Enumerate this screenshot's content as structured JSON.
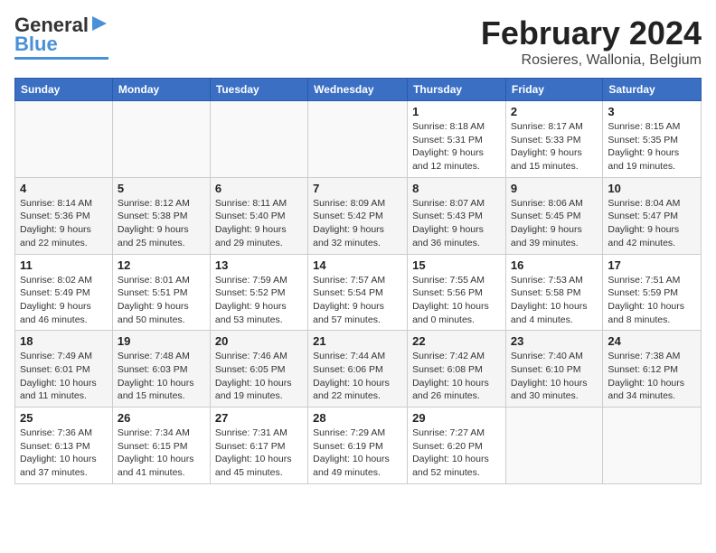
{
  "logo": {
    "line1": "General",
    "line2": "Blue"
  },
  "title": "February 2024",
  "subtitle": "Rosieres, Wallonia, Belgium",
  "days_of_week": [
    "Sunday",
    "Monday",
    "Tuesday",
    "Wednesday",
    "Thursday",
    "Friday",
    "Saturday"
  ],
  "weeks": [
    [
      {
        "day": "",
        "info": ""
      },
      {
        "day": "",
        "info": ""
      },
      {
        "day": "",
        "info": ""
      },
      {
        "day": "",
        "info": ""
      },
      {
        "day": "1",
        "info": "Sunrise: 8:18 AM\nSunset: 5:31 PM\nDaylight: 9 hours\nand 12 minutes."
      },
      {
        "day": "2",
        "info": "Sunrise: 8:17 AM\nSunset: 5:33 PM\nDaylight: 9 hours\nand 15 minutes."
      },
      {
        "day": "3",
        "info": "Sunrise: 8:15 AM\nSunset: 5:35 PM\nDaylight: 9 hours\nand 19 minutes."
      }
    ],
    [
      {
        "day": "4",
        "info": "Sunrise: 8:14 AM\nSunset: 5:36 PM\nDaylight: 9 hours\nand 22 minutes."
      },
      {
        "day": "5",
        "info": "Sunrise: 8:12 AM\nSunset: 5:38 PM\nDaylight: 9 hours\nand 25 minutes."
      },
      {
        "day": "6",
        "info": "Sunrise: 8:11 AM\nSunset: 5:40 PM\nDaylight: 9 hours\nand 29 minutes."
      },
      {
        "day": "7",
        "info": "Sunrise: 8:09 AM\nSunset: 5:42 PM\nDaylight: 9 hours\nand 32 minutes."
      },
      {
        "day": "8",
        "info": "Sunrise: 8:07 AM\nSunset: 5:43 PM\nDaylight: 9 hours\nand 36 minutes."
      },
      {
        "day": "9",
        "info": "Sunrise: 8:06 AM\nSunset: 5:45 PM\nDaylight: 9 hours\nand 39 minutes."
      },
      {
        "day": "10",
        "info": "Sunrise: 8:04 AM\nSunset: 5:47 PM\nDaylight: 9 hours\nand 42 minutes."
      }
    ],
    [
      {
        "day": "11",
        "info": "Sunrise: 8:02 AM\nSunset: 5:49 PM\nDaylight: 9 hours\nand 46 minutes."
      },
      {
        "day": "12",
        "info": "Sunrise: 8:01 AM\nSunset: 5:51 PM\nDaylight: 9 hours\nand 50 minutes."
      },
      {
        "day": "13",
        "info": "Sunrise: 7:59 AM\nSunset: 5:52 PM\nDaylight: 9 hours\nand 53 minutes."
      },
      {
        "day": "14",
        "info": "Sunrise: 7:57 AM\nSunset: 5:54 PM\nDaylight: 9 hours\nand 57 minutes."
      },
      {
        "day": "15",
        "info": "Sunrise: 7:55 AM\nSunset: 5:56 PM\nDaylight: 10 hours\nand 0 minutes."
      },
      {
        "day": "16",
        "info": "Sunrise: 7:53 AM\nSunset: 5:58 PM\nDaylight: 10 hours\nand 4 minutes."
      },
      {
        "day": "17",
        "info": "Sunrise: 7:51 AM\nSunset: 5:59 PM\nDaylight: 10 hours\nand 8 minutes."
      }
    ],
    [
      {
        "day": "18",
        "info": "Sunrise: 7:49 AM\nSunset: 6:01 PM\nDaylight: 10 hours\nand 11 minutes."
      },
      {
        "day": "19",
        "info": "Sunrise: 7:48 AM\nSunset: 6:03 PM\nDaylight: 10 hours\nand 15 minutes."
      },
      {
        "day": "20",
        "info": "Sunrise: 7:46 AM\nSunset: 6:05 PM\nDaylight: 10 hours\nand 19 minutes."
      },
      {
        "day": "21",
        "info": "Sunrise: 7:44 AM\nSunset: 6:06 PM\nDaylight: 10 hours\nand 22 minutes."
      },
      {
        "day": "22",
        "info": "Sunrise: 7:42 AM\nSunset: 6:08 PM\nDaylight: 10 hours\nand 26 minutes."
      },
      {
        "day": "23",
        "info": "Sunrise: 7:40 AM\nSunset: 6:10 PM\nDaylight: 10 hours\nand 30 minutes."
      },
      {
        "day": "24",
        "info": "Sunrise: 7:38 AM\nSunset: 6:12 PM\nDaylight: 10 hours\nand 34 minutes."
      }
    ],
    [
      {
        "day": "25",
        "info": "Sunrise: 7:36 AM\nSunset: 6:13 PM\nDaylight: 10 hours\nand 37 minutes."
      },
      {
        "day": "26",
        "info": "Sunrise: 7:34 AM\nSunset: 6:15 PM\nDaylight: 10 hours\nand 41 minutes."
      },
      {
        "day": "27",
        "info": "Sunrise: 7:31 AM\nSunset: 6:17 PM\nDaylight: 10 hours\nand 45 minutes."
      },
      {
        "day": "28",
        "info": "Sunrise: 7:29 AM\nSunset: 6:19 PM\nDaylight: 10 hours\nand 49 minutes."
      },
      {
        "day": "29",
        "info": "Sunrise: 7:27 AM\nSunset: 6:20 PM\nDaylight: 10 hours\nand 52 minutes."
      },
      {
        "day": "",
        "info": ""
      },
      {
        "day": "",
        "info": ""
      }
    ]
  ]
}
